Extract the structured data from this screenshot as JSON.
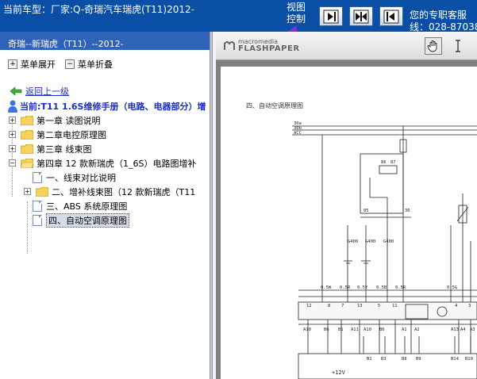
{
  "topbar": {
    "car_title": "当前车型：厂家:Q-奇瑞汽车瑞虎(T11)2012-",
    "view_control": [
      "视图",
      "控制"
    ],
    "nav_buttons": [
      "expand-right",
      "split-view",
      "collapse-left"
    ],
    "support_line1": "您的专职客服",
    "support_line2": "线：028-87038"
  },
  "left": {
    "header": "奇瑞--新瑞虎（T11）--2012-",
    "menu_expand": "菜单展开",
    "menu_collapse": "菜单折叠",
    "back_link": "返回上一级",
    "current": "当前:T11 1.6S维修手册（电路、电器部分）增",
    "tree": [
      {
        "label": "第一章 读图说明",
        "expander": "+",
        "icon": "folder"
      },
      {
        "label": "第二章电控原理图",
        "expander": "+",
        "icon": "folder"
      },
      {
        "label": "第三章 线束图",
        "expander": "+",
        "icon": "folder"
      },
      {
        "label": "第四章 12 款新瑞虎（1_6S）电路图增补",
        "expander": "−",
        "icon": "folder"
      },
      {
        "label": "一、线束对比说明",
        "expander": "",
        "icon": "doc"
      },
      {
        "label": "二、增补线束图（12 款新瑞虎（T11",
        "expander": "+",
        "icon": "folder"
      },
      {
        "label": "三、ABS 系统原理图",
        "expander": "",
        "icon": "doc"
      },
      {
        "label": "四、自动空调原理图",
        "expander": "",
        "icon": "doc",
        "selected": true
      }
    ]
  },
  "viewer": {
    "logo_top": "macromedia",
    "logo_bottom": "FLASHPAPER",
    "tools": [
      "hand-tool-icon",
      "text-cursor-icon"
    ],
    "page_heading": "四、自动空调原理图",
    "diagram_labels": {
      "top_left": [
        "30a",
        "30b",
        "ACC"
      ],
      "fuses": [
        "12",
        "8",
        "7",
        "13",
        "5",
        "11",
        "4",
        "3"
      ],
      "connectors_bottom": [
        "A10",
        "B6",
        "B1",
        "A11",
        "A10",
        "B6",
        "A1",
        "A2",
        "A13",
        "A4",
        "A3"
      ],
      "bottom_row": [
        "B1",
        "B3",
        "B8",
        "B9",
        "B14",
        "B10"
      ],
      "voltage": "+12V",
      "relay_pins": [
        "86",
        "87",
        "85",
        "30"
      ],
      "wire_codes": [
        "0.5W",
        "0.5R",
        "0.5Y",
        "0.5B",
        "0.5R",
        "0.5G"
      ],
      "ground_codes": [
        "G400",
        "G400",
        "G400"
      ]
    }
  }
}
